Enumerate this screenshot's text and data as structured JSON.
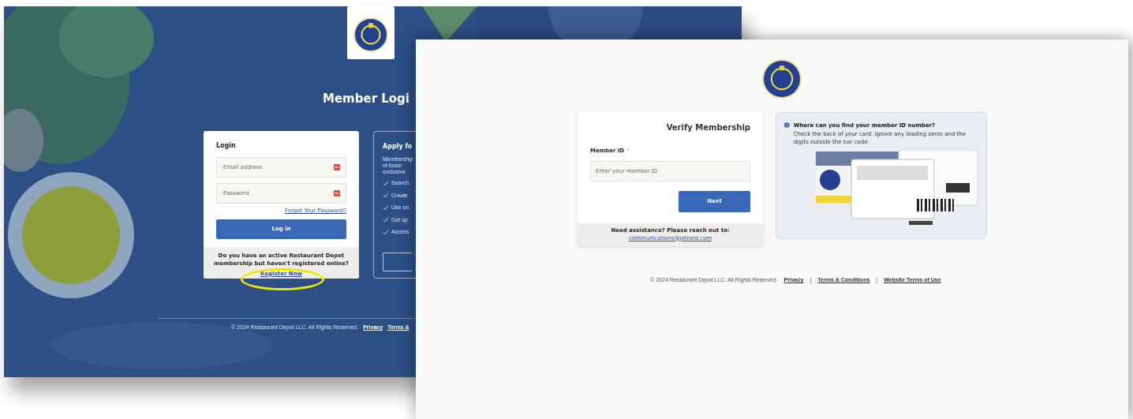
{
  "login_screen": {
    "heading": "Member Logi",
    "login_card": {
      "title": "Login",
      "fields": [
        {
          "placeholder": "Email address"
        },
        {
          "placeholder": "Password"
        }
      ],
      "forgot_link": "Forgot Your Password?",
      "button": "Log in",
      "prompt": "Do you have an active Restaurant Depot membership but haven't registered online?",
      "register_link": {
        "label": "Register Now",
        "highlighted": true
      }
    },
    "apply_card": {
      "title": "Apply fo",
      "text_lines": [
        "Membership",
        "of busin",
        "exclusive"
      ],
      "benefits": [
        "Search",
        "Create",
        "Use on",
        "Get op",
        "Access"
      ]
    },
    "footer": {
      "copyright": "© 2024 Restaurant Depot LLC. All Rights Reserved.",
      "links": [
        "Privacy",
        "Terms &"
      ]
    }
  },
  "verify_screen": {
    "title": "Verify Membership",
    "field": {
      "label": "Member ID",
      "required_mark": "*",
      "placeholder": "Enter your member ID"
    },
    "button": "Next",
    "assistance": {
      "text": "Need assistance? Please reach out to:",
      "email": "communications@jetrord.com"
    },
    "info": {
      "question": "Where can you find your member ID number?",
      "text": "Check the back of your card. Ignore any leading zeros and the digits outside the bar code."
    },
    "footer": {
      "copyright": "© 2024 Restaurant Depot LLC. All Rights Reserved.",
      "separator": "|",
      "links": [
        "Privacy",
        "Terms & Conditions",
        "Website Terms of Use"
      ]
    }
  }
}
